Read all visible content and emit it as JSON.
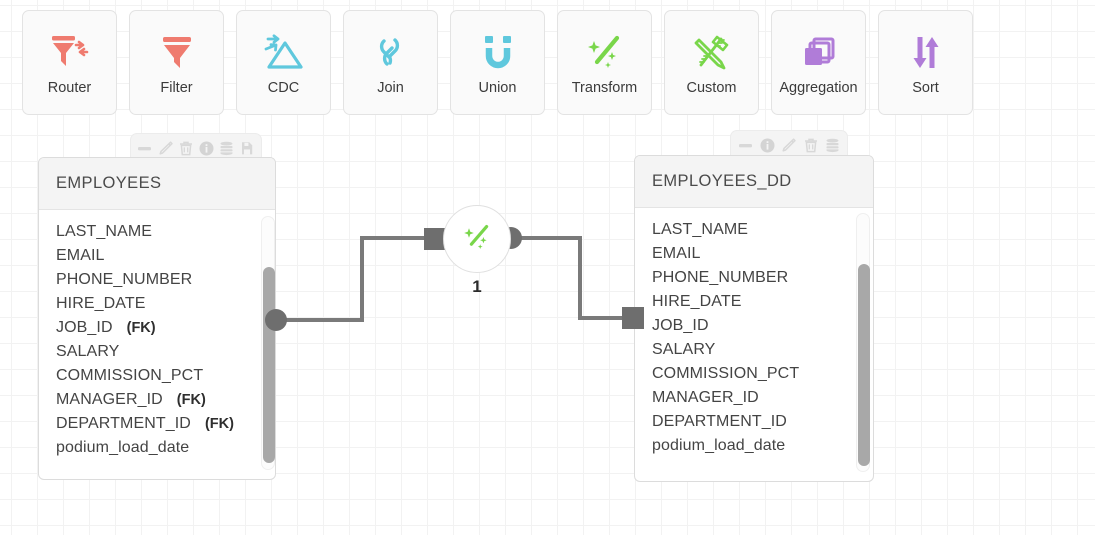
{
  "palette": {
    "items": [
      {
        "label": "Router",
        "icon": "router-icon",
        "color": "#ef7b6f"
      },
      {
        "label": "Filter",
        "icon": "filter-icon",
        "color": "#ef7b6f"
      },
      {
        "label": "CDC",
        "icon": "cdc-icon",
        "color": "#5fc8dd"
      },
      {
        "label": "Join",
        "icon": "join-icon",
        "color": "#5fc8dd"
      },
      {
        "label": "Union",
        "icon": "union-icon",
        "color": "#5fc8dd"
      },
      {
        "label": "Transform",
        "icon": "transform-icon",
        "color": "#79d64a"
      },
      {
        "label": "Custom",
        "icon": "custom-icon",
        "color": "#79d64a"
      },
      {
        "label": "Aggregation",
        "icon": "aggregation-icon",
        "color": "#b07cd8"
      },
      {
        "label": "Sort",
        "icon": "sort-icon",
        "color": "#b07cd8"
      }
    ]
  },
  "source_node": {
    "title": "EMPLOYEES",
    "toolbar_icons": [
      "minus-icon",
      "pencil-icon",
      "trash-icon",
      "info-icon",
      "database-icon",
      "file-icon"
    ],
    "columns": [
      {
        "name": "LAST_NAME",
        "key": ""
      },
      {
        "name": "EMAIL",
        "key": ""
      },
      {
        "name": "PHONE_NUMBER",
        "key": ""
      },
      {
        "name": "HIRE_DATE",
        "key": ""
      },
      {
        "name": "JOB_ID",
        "key": "(FK)"
      },
      {
        "name": "SALARY",
        "key": ""
      },
      {
        "name": "COMMISSION_PCT",
        "key": ""
      },
      {
        "name": "MANAGER_ID",
        "key": "(FK)"
      },
      {
        "name": "DEPARTMENT_ID",
        "key": "(FK)"
      },
      {
        "name": "podium_load_date",
        "key": ""
      }
    ]
  },
  "target_node": {
    "title": "EMPLOYEES_DD",
    "toolbar_icons": [
      "minus-icon",
      "info-icon",
      "pencil-icon",
      "trash-icon",
      "database-icon"
    ],
    "columns": [
      {
        "name": "LAST_NAME",
        "key": ""
      },
      {
        "name": "EMAIL",
        "key": ""
      },
      {
        "name": "PHONE_NUMBER",
        "key": ""
      },
      {
        "name": "HIRE_DATE",
        "key": ""
      },
      {
        "name": "JOB_ID",
        "key": ""
      },
      {
        "name": "SALARY",
        "key": ""
      },
      {
        "name": "COMMISSION_PCT",
        "key": ""
      },
      {
        "name": "MANAGER_ID",
        "key": ""
      },
      {
        "name": "DEPARTMENT_ID",
        "key": ""
      },
      {
        "name": "podium_load_date",
        "key": ""
      }
    ]
  },
  "transform_node": {
    "label": "1",
    "icon": "transform-icon"
  },
  "colors": {
    "edge": "#7a7a7a",
    "port": "#6e6e6e",
    "grid": "#f2f2f2"
  }
}
